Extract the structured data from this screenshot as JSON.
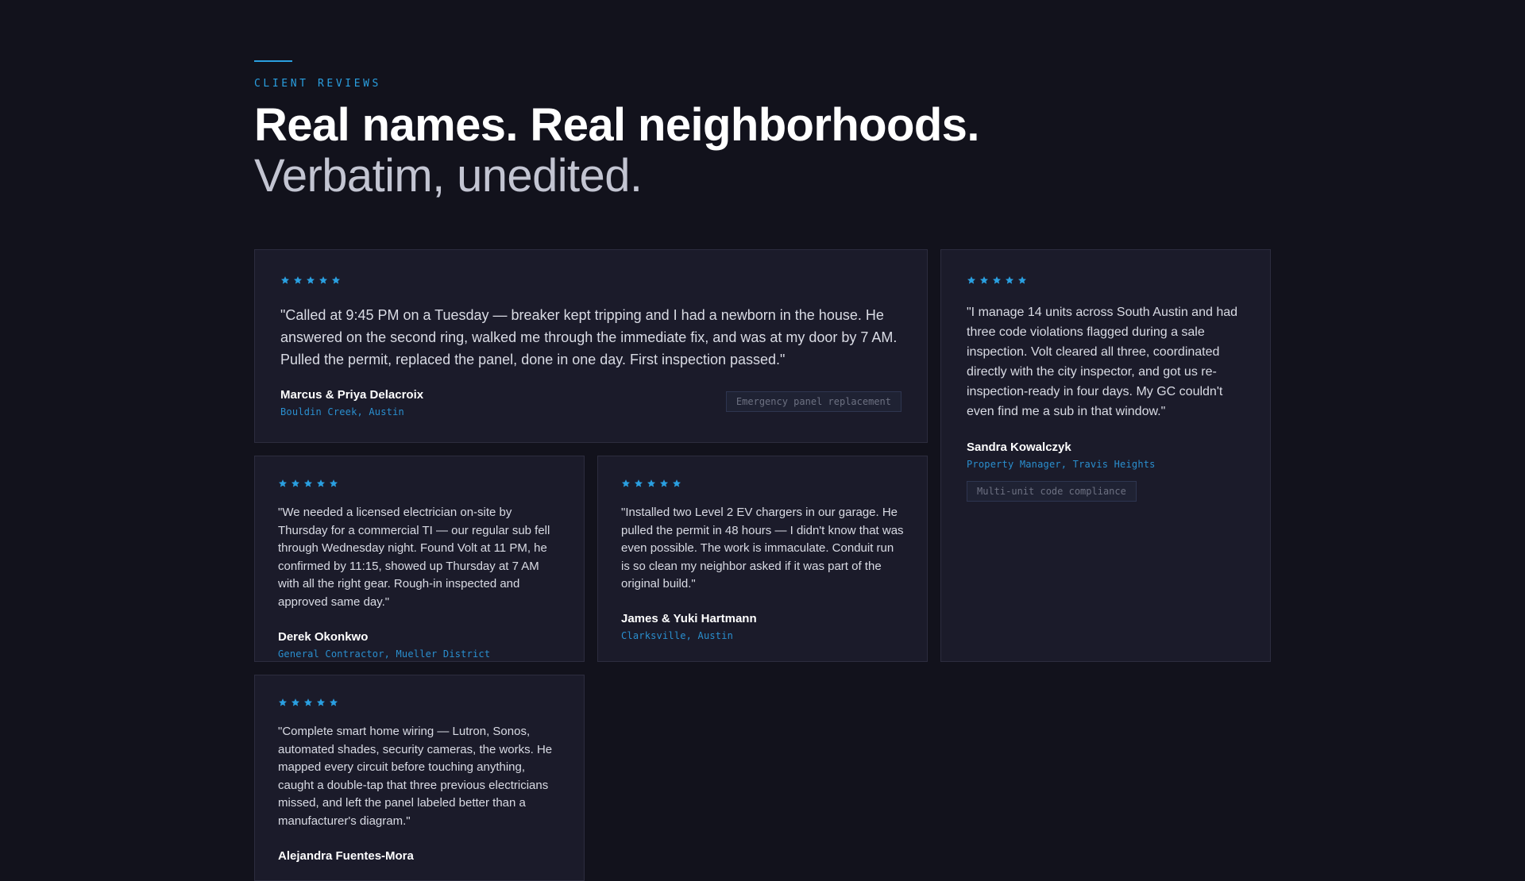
{
  "header": {
    "eyebrow": "CLIENT REVIEWS",
    "headline": "Real names. Real neighborhoods.",
    "subhead": "Verbatim, unedited."
  },
  "colors": {
    "accent": "#2a9fe0",
    "background": "#12121c",
    "card": "#1b1b2a"
  },
  "reviews": [
    {
      "rating": 5,
      "quote": "\"Called at 9:45 PM on a Tuesday — breaker kept tripping and I had a newborn in the house. He answered on the second ring, walked me through the immediate fix, and was at my door by 7 AM. Pulled the permit, replaced the panel, done in one day. First inspection passed.\"",
      "name": "Marcus & Priya Delacroix",
      "meta": "Bouldin Creek, Austin",
      "tag": "Emergency panel replacement"
    },
    {
      "rating": 5,
      "quote": "\"I manage 14 units across South Austin and had three code violations flagged during a sale inspection. Volt cleared all three, coordinated directly with the city inspector, and got us re-inspection-ready in four days. My GC couldn't even find me a sub in that window.\"",
      "name": "Sandra Kowalczyk",
      "meta": "Property Manager, Travis Heights",
      "tag": "Multi-unit code compliance"
    },
    {
      "rating": 5,
      "quote": "\"We needed a licensed electrician on-site by Thursday for a commercial TI — our regular sub fell through Wednesday night. Found Volt at 11 PM, he confirmed by 11:15, showed up Thursday at 7 AM with all the right gear. Rough-in inspected and approved same day.\"",
      "name": "Derek Okonkwo",
      "meta": "General Contractor, Mueller District"
    },
    {
      "rating": 5,
      "quote": "\"Installed two Level 2 EV chargers in our garage. He pulled the permit in 48 hours — I didn't know that was even possible. The work is immaculate. Conduit run is so clean my neighbor asked if it was part of the original build.\"",
      "name": "James & Yuki Hartmann",
      "meta": "Clarksville, Austin"
    },
    {
      "rating": 5,
      "quote": "\"Complete smart home wiring — Lutron, Sonos, automated shades, security cameras, the works. He mapped every circuit before touching anything, caught a double-tap that three previous electricians missed, and left the panel labeled better than a manufacturer's diagram.\"",
      "name": "Alejandra Fuentes-Mora"
    }
  ]
}
